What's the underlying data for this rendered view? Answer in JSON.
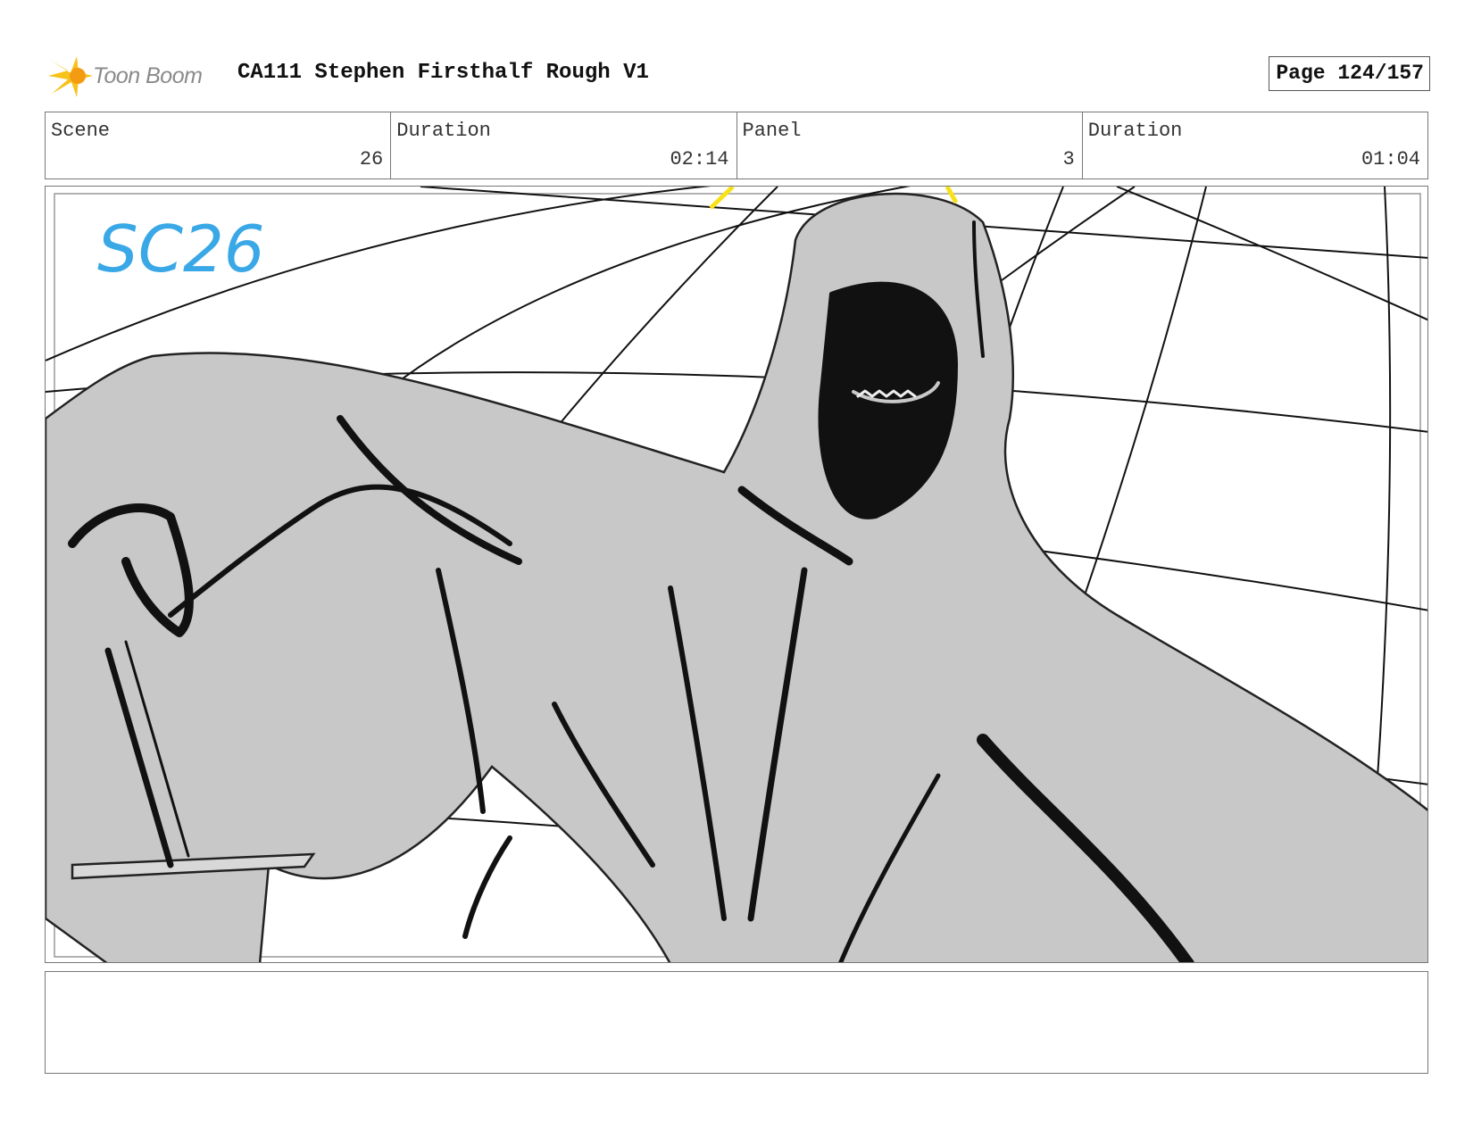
{
  "header": {
    "logo_text": "Toon Boom",
    "title": "CA111 Stephen Firsthalf Rough V1",
    "page": "Page 124/157"
  },
  "info": {
    "scene_label": "Scene",
    "scene_value": "26",
    "scene_duration_label": "Duration",
    "scene_duration_value": "02:14",
    "panel_label": "Panel",
    "panel_value": "3",
    "panel_duration_label": "Duration",
    "panel_duration_value": "01:04"
  },
  "panel": {
    "handwritten_note": "SC26",
    "note_color": "#3aa8e6",
    "fill_color": "#c8c8c8",
    "ink_color": "#111111"
  },
  "notes": {
    "text": ""
  }
}
